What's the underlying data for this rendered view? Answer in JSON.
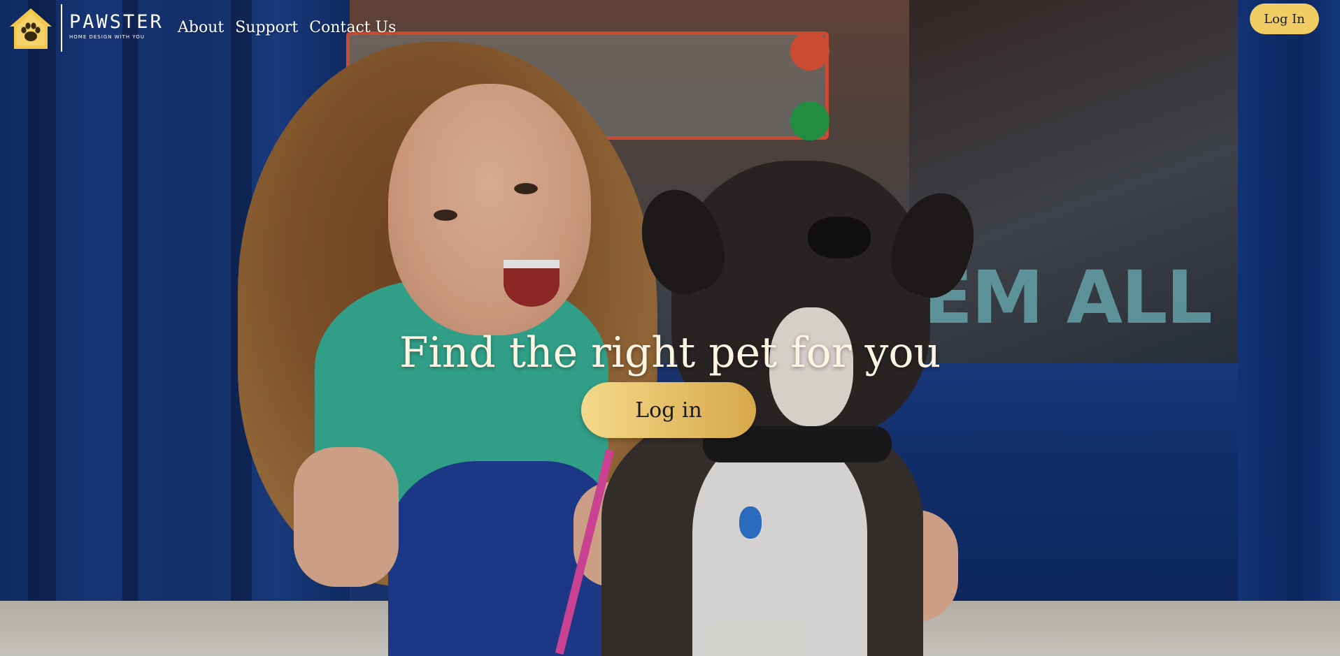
{
  "brand": {
    "name": "PAWSTER",
    "tagline": "HOME DESIGN WITH YOU"
  },
  "nav": {
    "items": [
      {
        "label": "About"
      },
      {
        "label": "Support"
      },
      {
        "label": "Contact Us"
      }
    ]
  },
  "header": {
    "login_label": "Log In"
  },
  "hero": {
    "title": "Find the right pet for you",
    "cta_label": "Log in",
    "window_sign_text": "EM ALL"
  },
  "colors": {
    "accent_yellow": "#f1cc63",
    "hero_text": "#fdf4e3",
    "brand_icon": "#f4c64a"
  },
  "icons": {
    "logo": "house-paw-icon"
  }
}
